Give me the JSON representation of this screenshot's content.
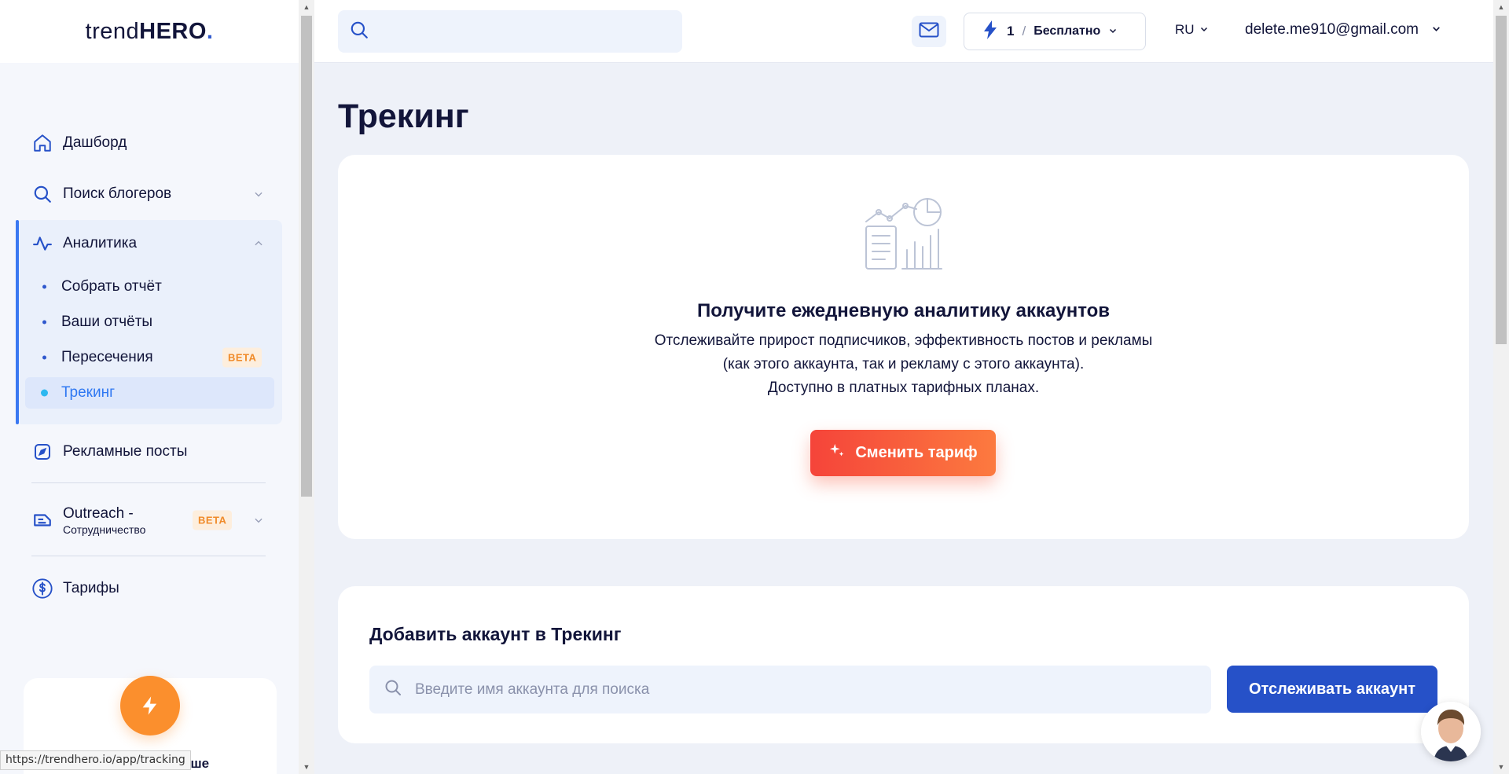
{
  "logo": {
    "text_light": "trend",
    "text_bold": "HERO",
    "dot": "."
  },
  "sidebar": {
    "items": [
      {
        "label": "Дашборд",
        "icon": "home-icon"
      },
      {
        "label": "Поиск блогеров",
        "icon": "search-icon"
      },
      {
        "label": "Аналитика",
        "icon": "activity-icon"
      },
      {
        "label": "Рекламные посты",
        "icon": "compass-icon"
      },
      {
        "label": "Outreach -",
        "sublabel": "Сотрудничество",
        "icon": "outreach-icon",
        "badge": "BETA"
      },
      {
        "label": "Тарифы",
        "icon": "dollar-icon"
      }
    ],
    "analytics_sub": [
      {
        "label": "Собрать отчёт"
      },
      {
        "label": "Ваши отчёты"
      },
      {
        "label": "Пересечения",
        "badge": "BETA"
      },
      {
        "label": "Трекинг",
        "active": true
      }
    ],
    "promo_text": "ьше",
    "status_url": "https://trendhero.io/app/tracking"
  },
  "header": {
    "search_placeholder": "",
    "plan_count": "1",
    "plan_slash": "/",
    "plan_name": "Бесплатно",
    "language": "RU",
    "email": "delete.me910@gmail.com"
  },
  "main": {
    "page_title": "Трекинг",
    "card": {
      "title": "Получите ежедневную аналитику аккаунтов",
      "desc_line1": "Отслеживайте прирост подписчиков, эффективность постов и рекламы",
      "desc_line2": "(как этого аккаунта, так и рекламу с этого аккаунта).",
      "desc_line3": "Доступно в платных тарифных планах.",
      "button": "Сменить тариф"
    },
    "add_account": {
      "title": "Добавить аккаунт в Трекинг",
      "placeholder": "Введите имя аккаунта для поиска",
      "button": "Отслеживать аккаунт"
    }
  },
  "colors": {
    "primary": "#2651c8",
    "accent_orange": "#fb8f2d",
    "cta_red": "#f5443a",
    "text_dark": "#12153a",
    "active_link": "#2f78f2"
  }
}
